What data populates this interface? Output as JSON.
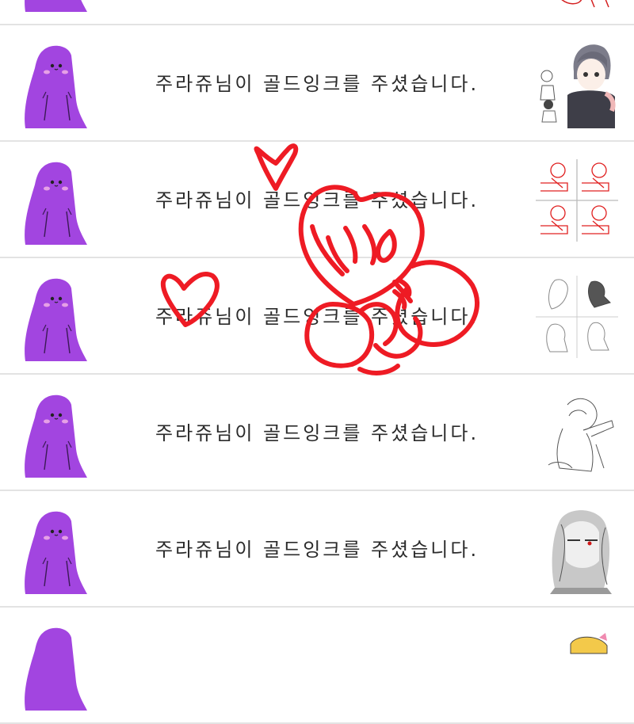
{
  "notifications": [
    {
      "message": "",
      "thumbnail": "red-sketch-partial"
    },
    {
      "message": "주라쥬님이 골드잉크를 주셨습니다.",
      "thumbnail": "anime-girl-sketch"
    },
    {
      "message": "주라쥬님이 골드잉크를 주셨습니다.",
      "thumbnail": "red-comic-panels"
    },
    {
      "message": "주라쥬님이 골드잉크를 주셨습니다.",
      "thumbnail": "gray-comic-panels"
    },
    {
      "message": "주라쥬님이 골드잉크를 주셨습니다.",
      "thumbnail": "line-sketch"
    },
    {
      "message": "주라쥬님이 골드잉크를 주셨습니다.",
      "thumbnail": "gray-portrait-sketch"
    },
    {
      "message": "",
      "thumbnail": "blonde-character-partial"
    }
  ],
  "colors": {
    "avatar_purple": "#a245e0",
    "divider": "#e3e3e3",
    "doodle_red": "#ee1b24"
  }
}
